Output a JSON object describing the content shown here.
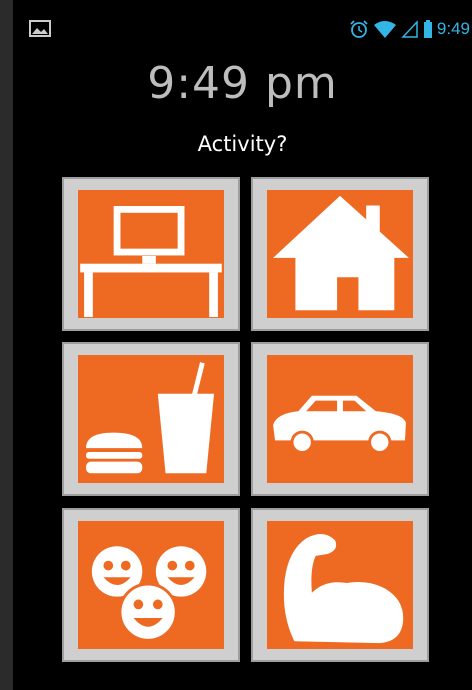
{
  "status_bar": {
    "time": "9:49",
    "icons": [
      "image-notification-icon",
      "alarm-icon",
      "wifi-icon",
      "signal-icon",
      "battery-icon"
    ]
  },
  "clock": {
    "time": "9:49 pm"
  },
  "prompt": {
    "question": "Activity?"
  },
  "tiles": [
    {
      "name": "work-desk",
      "icon": "desk-computer-icon"
    },
    {
      "name": "home",
      "icon": "house-icon"
    },
    {
      "name": "eating",
      "icon": "burger-drink-icon"
    },
    {
      "name": "driving",
      "icon": "car-icon"
    },
    {
      "name": "social",
      "icon": "smiley-faces-icon"
    },
    {
      "name": "exercise",
      "icon": "flexed-arm-icon"
    }
  ],
  "colors": {
    "tile_orange": "#ee6a23",
    "tile_frame": "#cfcfcf",
    "status_accent": "#33b5e5",
    "background": "#000000"
  }
}
